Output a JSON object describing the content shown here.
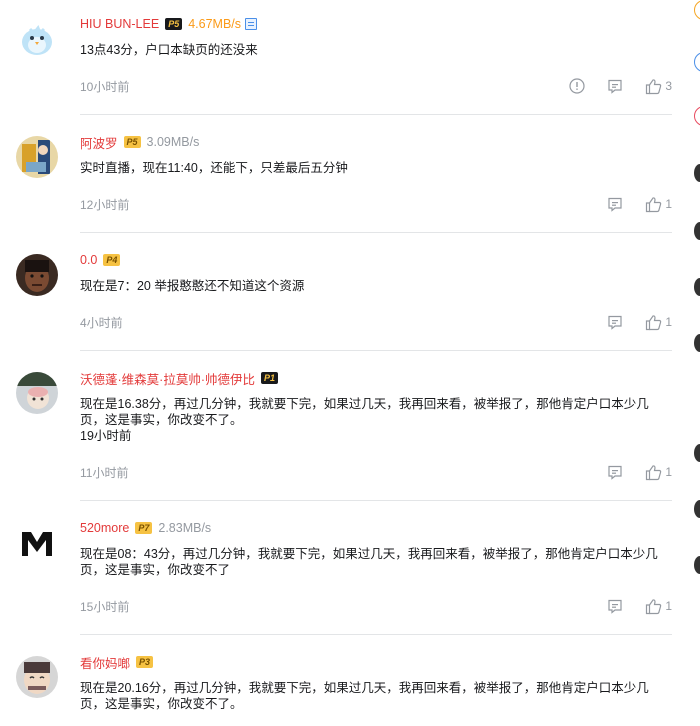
{
  "comments": [
    {
      "username": "HIU BUN-LEE",
      "level": "5",
      "level_style": "dark",
      "speed": "4.67MB/s",
      "speed_style": "orange",
      "vip": true,
      "text": "13点43分，户口本缺页的还没来",
      "time": "10小时前",
      "likes": "3",
      "report": true,
      "avatar": "bird"
    },
    {
      "username": "阿波罗",
      "level": "5",
      "level_style": "yel",
      "speed": "3.09MB/s",
      "speed_style": "gray",
      "vip": false,
      "text": "实时直播，现在11:40，还能下，只差最后五分钟",
      "time": "12小时前",
      "likes": "1",
      "report": false,
      "avatar": "anime"
    },
    {
      "username": "0.0",
      "level": "4",
      "level_style": "yel",
      "speed": "",
      "speed_style": "gray",
      "vip": false,
      "text": "现在是7：20 举报憨憨还不知道这个资源",
      "time": "4小时前",
      "likes": "1",
      "report": false,
      "avatar": "person"
    },
    {
      "username": "沃德蓬·维森莫·拉莫帅·帅德伊比",
      "level": "1",
      "level_style": "dark",
      "speed": "",
      "speed_style": "gray",
      "vip": false,
      "text": "现在是16.38分，再过几分钟，我就要下完，如果过几天，我再回来看，被举报了，那他肯定户口本少几页，这是事实，你改变不了。\n19小时前",
      "time": "11小时前",
      "likes": "1",
      "report": false,
      "avatar": "meme"
    },
    {
      "username": "520more",
      "level": "7",
      "level_style": "yel",
      "speed": "2.83MB/s",
      "speed_style": "gray",
      "vip": false,
      "text": "现在是08：43分，再过几分钟，我就要下完，如果过几天，我再回来看，被举报了，那他肯定户口本少几页，这是事实，你改变不了",
      "time": "15小时前",
      "likes": "1",
      "report": false,
      "avatar": "logo"
    },
    {
      "username": "看你妈啷",
      "level": "3",
      "level_style": "yel",
      "speed": "",
      "speed_style": "gray",
      "vip": false,
      "text": "现在是20.16分，再过几分钟，我就要下完，如果过几天，我再回来看，被举报了，那他肯定户口本少几页，这是事实，你改变不了。",
      "time": "",
      "likes": "",
      "report": false,
      "avatar": "sad"
    }
  ],
  "edge_colors": [
    "#f6a623",
    "#4a8fe8",
    "#e84a5f"
  ]
}
